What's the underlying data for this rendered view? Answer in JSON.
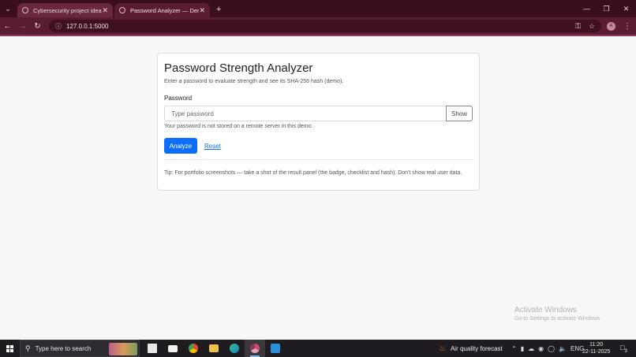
{
  "browser": {
    "tabs": [
      {
        "title": "Cybersecurity project ideas",
        "active": false
      },
      {
        "title": "Password Analyzer — Demo",
        "active": true
      }
    ],
    "new_tab": "+",
    "url": "127.0.0.1:5000",
    "profile_initial": "A"
  },
  "page": {
    "title": "Password Strength Analyzer",
    "subtitle": "Enter a password to evaluate strength and see its SHA-256 hash (demo).",
    "password_label": "Password",
    "password_placeholder": "Type password",
    "show_label": "Show",
    "storage_note": "Your password is not stored on a remote server in this demo.",
    "analyze_label": "Analyze",
    "reset_label": "Reset",
    "tip": "Tip: For portfolio screenshots — take a shot of the result panel (the badge, checklist and hash). Don't show real user data.",
    "accent_color": "#0d6efd"
  },
  "watermark": {
    "line1": "Activate Windows",
    "line2": "Go to Settings to activate Windows."
  },
  "taskbar": {
    "search_placeholder": "Type here to search",
    "weather": "Air quality forecast",
    "language": "ENG",
    "time": "11:20",
    "date": "22-11-2025",
    "notification_count": "3"
  }
}
